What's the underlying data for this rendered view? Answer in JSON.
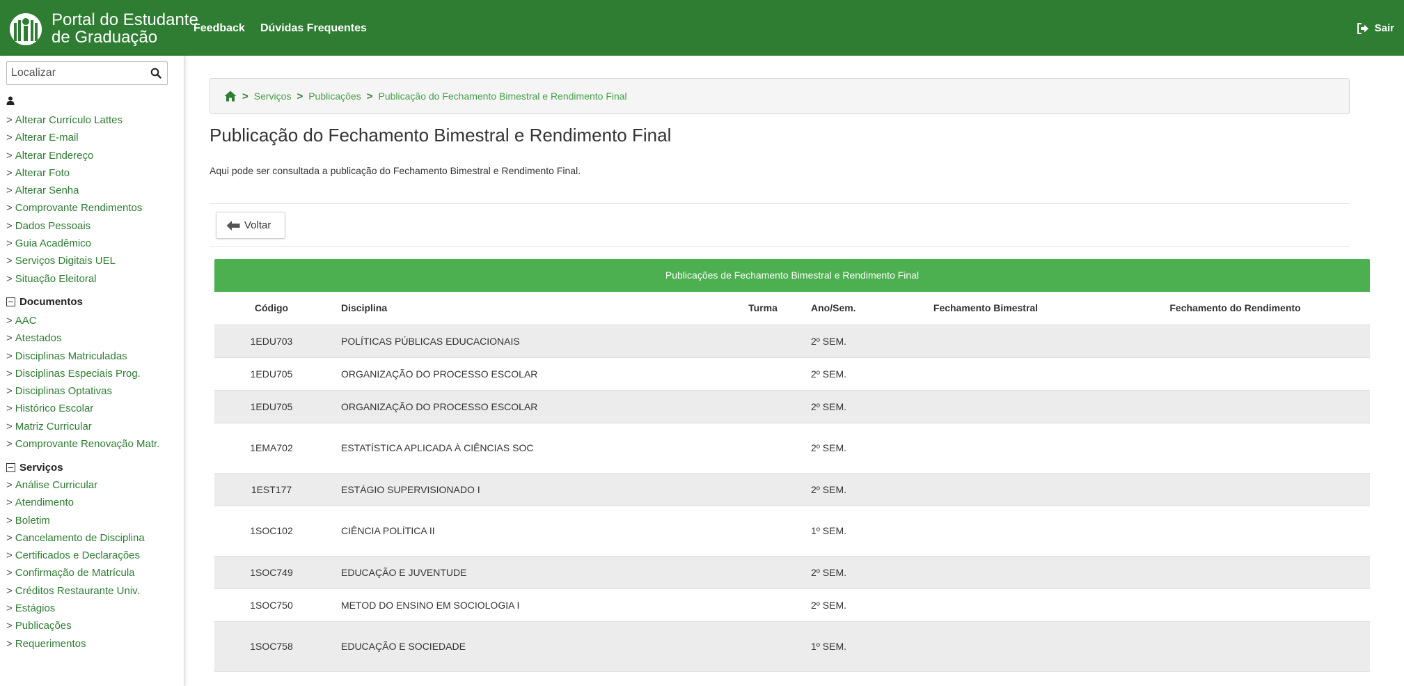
{
  "header": {
    "brand_line1": "Portal do Estudante",
    "brand_line2": "de Graduação",
    "nav": [
      "Feedback",
      "Dúvidas Frequentes"
    ],
    "logout_label": "Sair",
    "bg_color": "#2e7d32"
  },
  "sidebar": {
    "search_placeholder": "Localizar",
    "user_items": [
      "Alterar Currículo Lattes",
      "Alterar E-mail",
      "Alterar Endereço",
      "Alterar Foto",
      "Alterar Senha",
      "Comprovante Rendimentos",
      "Dados Pessoais",
      "Guia Acadêmico",
      "Serviços Digitais UEL",
      "Situação Eleitoral"
    ],
    "documentos_title": "Documentos",
    "documentos_items": [
      "AAC",
      "Atestados",
      "Disciplinas Matriculadas",
      "Disciplinas Especiais Prog.",
      "Disciplinas Optativas",
      "Histórico Escolar",
      "Matriz Curricular",
      "Comprovante Renovação Matr."
    ],
    "servicos_title": "Serviços",
    "servicos_items": [
      "Análise Curricular",
      "Atendimento",
      "Boletim",
      "Cancelamento de Disciplina",
      "Certificados e Declarações",
      "Confirmação de Matrícula",
      "Créditos Restaurante Univ.",
      "Estágios",
      "Publicações",
      "Requerimentos"
    ]
  },
  "breadcrumb": {
    "items": [
      "Serviços",
      "Publicações",
      "Publicação do Fechamento Bimestral e Rendimento Final"
    ]
  },
  "page": {
    "title": "Publicação do Fechamento Bimestral e Rendimento Final",
    "description": "Aqui pode ser consultada a publicação do Fechamento Bimestral e Rendimento Final.",
    "back_label": "Voltar"
  },
  "table": {
    "caption": "Publicações de Fechamento Bimestral e Rendimento Final",
    "headers": [
      "Código",
      "Disciplina",
      "Turma",
      "Ano/Sem.",
      "Fechamento Bimestral",
      "Fechamento do Rendimento"
    ],
    "rows": [
      {
        "codigo": "1EDU703",
        "disciplina": "POLÍTICAS PÚBLICAS EDUCACIONAIS",
        "turma": "",
        "ano": "2º SEM.",
        "fb": "",
        "fr": "",
        "tall": false
      },
      {
        "codigo": "1EDU705",
        "disciplina": "ORGANIZAÇÃO DO PROCESSO ESCOLAR",
        "turma": "",
        "ano": "2º SEM.",
        "fb": "",
        "fr": "",
        "tall": false
      },
      {
        "codigo": "1EDU705",
        "disciplina": "ORGANIZAÇÃO DO PROCESSO ESCOLAR",
        "turma": "",
        "ano": "2º SEM.",
        "fb": "",
        "fr": "",
        "tall": false
      },
      {
        "codigo": "1EMA702",
        "disciplina": "ESTATÍSTICA APLICADA À CIÊNCIAS SOC",
        "turma": "",
        "ano": "2º SEM.",
        "fb": "",
        "fr": "",
        "tall": true
      },
      {
        "codigo": "1EST177",
        "disciplina": "ESTÁGIO SUPERVISIONADO I",
        "turma": "",
        "ano": "2º SEM.",
        "fb": "",
        "fr": "",
        "tall": false
      },
      {
        "codigo": "1SOC102",
        "disciplina": "CIÊNCIA POLÍTICA II",
        "turma": "",
        "ano": "1º SEM.",
        "fb": "",
        "fr": "",
        "tall": true
      },
      {
        "codigo": "1SOC749",
        "disciplina": "EDUCAÇÃO E JUVENTUDE",
        "turma": "",
        "ano": "2º SEM.",
        "fb": "",
        "fr": "",
        "tall": false
      },
      {
        "codigo": "1SOC750",
        "disciplina": "METOD DO ENSINO EM SOCIOLOGIA I",
        "turma": "",
        "ano": "2º SEM.",
        "fb": "",
        "fr": "",
        "tall": false
      },
      {
        "codigo": "1SOC758",
        "disciplina": "EDUCAÇÃO E SOCIEDADE",
        "turma": "",
        "ano": "1º SEM.",
        "fb": "",
        "fr": "",
        "tall": true
      }
    ]
  },
  "colors": {
    "accent": "#2e7d32",
    "link": "#2e7d32",
    "table_caption": "#4caf50",
    "row_alt": "#ececec"
  },
  "icons": {
    "logo": "uel-logo-icon",
    "logout": "sign-out-icon",
    "search": "search-icon",
    "user": "user-icon",
    "section": "minus-square-icon",
    "home": "home-icon",
    "back": "arrow-left-icon"
  }
}
